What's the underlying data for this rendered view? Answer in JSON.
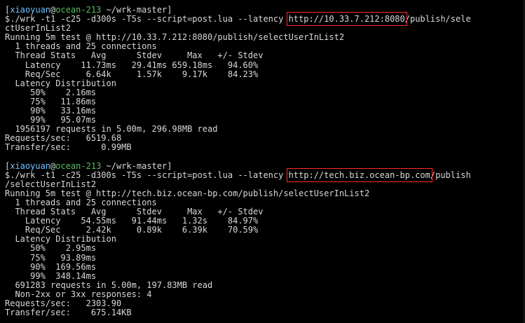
{
  "session1": {
    "prompt_open": "[",
    "user": "xiaoyuan",
    "at": "@",
    "host": "ocean-213",
    "cwd": " ~/wrk-master]",
    "cmd_prefix": "$./wrk -t1 -c25 -d300s -T5s --script=post.lua --latency ",
    "cmd_url": "http://10.33.7.212:8080",
    "cmd_suffix_a": "/publish/sele",
    "cmd_suffix_b": "ctUserInList2",
    "lines": [
      "Running 5m test @ http://10.33.7.212:8080/publish/selectUserInList2",
      "  1 threads and 25 connections",
      "  Thread Stats   Avg      Stdev     Max   +/- Stdev",
      "    Latency    11.73ms   29.41ms 659.18ms   94.60%",
      "    Req/Sec     6.64k     1.57k    9.17k    84.23%",
      "  Latency Distribution",
      "     50%    2.16ms",
      "     75%   11.86ms",
      "     90%   33.16ms",
      "     99%   95.07ms",
      "  1956197 requests in 5.00m, 296.98MB read",
      "Requests/sec:   6519.68",
      "Transfer/sec:      0.99MB"
    ]
  },
  "session2": {
    "prompt_open": "[",
    "user": "xiaoyuan",
    "at": "@",
    "host": "ocean-213",
    "cwd": " ~/wrk-master]",
    "cmd_prefix": "$./wrk -t1 -c25 -d300s -T5s --script=post.lua --latency ",
    "cmd_url": "http://tech.biz.ocean-bp.com",
    "cmd_suffix_a": "/publish",
    "cmd_suffix_b": "/selectUserInList2",
    "lines": [
      "Running 5m test @ http://tech.biz.ocean-bp.com/publish/selectUserInList2",
      "  1 threads and 25 connections",
      "  Thread Stats   Avg      Stdev     Max   +/- Stdev",
      "    Latency    54.55ms   91.44ms   1.32s    84.97%",
      "    Req/Sec     2.42k     0.89k    6.39k    70.59%",
      "  Latency Distribution",
      "     50%    2.95ms",
      "     75%   93.89ms",
      "     90%  169.56ms",
      "     99%  348.14ms",
      "  691283 requests in 5.00m, 197.83MB read",
      "  Non-2xx or 3xx responses: 4",
      "Requests/sec:   2303.90",
      "Transfer/sec:    675.14KB"
    ]
  },
  "colors": {
    "background": "#000000",
    "text": "#d8d8d8",
    "user": "#6fc3ff",
    "host": "#58c15e",
    "highlight_box": "#ff2a2a"
  }
}
